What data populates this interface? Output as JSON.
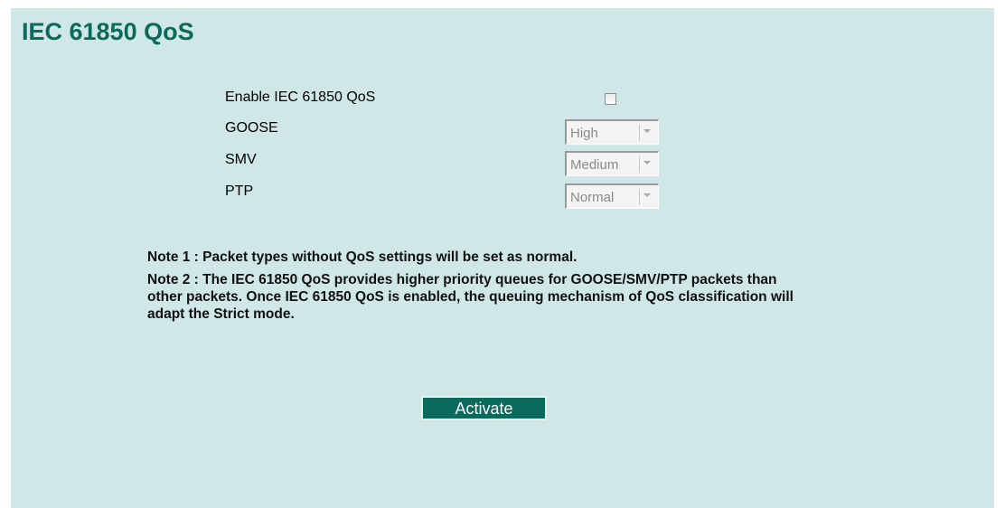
{
  "page": {
    "title": "IEC 61850 QoS"
  },
  "form": {
    "enable_label": "Enable IEC 61850 QoS",
    "enable_checked": false,
    "goose_label": "GOOSE",
    "goose_value": "High",
    "smv_label": "SMV",
    "smv_value": "Medium",
    "ptp_label": "PTP",
    "ptp_value": "Normal"
  },
  "notes": {
    "note1": "Note 1 : Packet types without QoS settings will be set as normal.",
    "note2": "Note 2 : The IEC 61850 QoS provides higher priority queues for GOOSE/SMV/PTP packets than other packets. Once IEC 61850 QoS is enabled, the queuing mechanism of QoS classification will adapt the Strict mode."
  },
  "actions": {
    "activate_label": "Activate"
  },
  "colors": {
    "panel_background": "#cfe7e7",
    "title": "#0b6a5a",
    "button_background": "#0a6b5c"
  },
  "icons": {
    "dropdown": "chevron-down-icon"
  }
}
